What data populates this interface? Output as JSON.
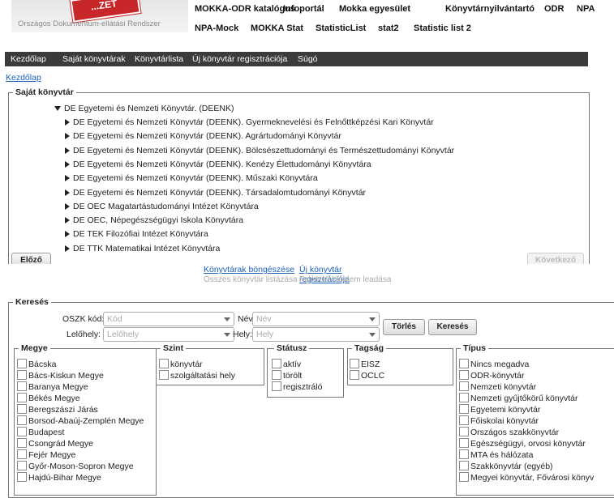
{
  "header": {
    "logo_stamp": "...ZET",
    "logo_caption": "Országos Dokumentum-ellátási Rendszer",
    "top_nav_row1": [
      "MOKKA-ODR katalógus",
      "Infoportál",
      "Mokka egyesület",
      "Könyvtárnyilvántartó",
      "ODR",
      "NPA"
    ],
    "top_nav_row2": [
      "NPA-Mock",
      "MOKKA Stat",
      "StatisticList",
      "stat2",
      "Statistic list 2"
    ]
  },
  "menubar": [
    "Kezdőlap",
    "Saját könyvtárak",
    "Könyvtárlista",
    "Új könyvtár regisztrációja",
    "Súgó"
  ],
  "breadcrumb": "Kezdőlap",
  "own_libraries": {
    "legend": "Saját könyvtár",
    "root": "DE Egyetemi és Nemzeti Könyvtár. (DEENK)",
    "children": [
      "DE Egyetemi és Nemzeti Könyvtár (DEENK). Gyermeknevelési és Felnőttképzési Kari Könyvtár",
      "DE Egyetemi és Nemzeti Könyvtár (DEENK). Agrártudományi Könyvtár",
      "DE Egyetemi és Nemzeti Könyvtár (DEENK). Bölcsészettudományi és Természettudományi Könyvtár",
      "DE Egyetemi és Nemzeti Könyvtár (DEENK). Kenézy Élettudományi Könyvtára",
      "DE Egyetemi és Nemzeti Könyvtár (DEENK). Műszaki Könyvtára",
      "DE Egyetemi és Nemzeti Könyvtár (DEENK). Társadalomtudományi Könyvtár",
      "DE OEC Magatartástudományi Intézet Könyvtára",
      "DE OEC, Népegészségügyi Iskola Könyvtára",
      "DE TEK Filozófiai Intézet Könyvtára",
      "DE TTK Matematikai Intézet Könyvtára"
    ],
    "prev_label": "Előző",
    "next_label": "Következő"
  },
  "links": {
    "browse": "Könyvtárak böngészése",
    "browse_sub": "Összes könyvtár listázása",
    "register": "Új könyvtár regisztrációja",
    "register_sub": "Felvételi kérelem leadása"
  },
  "search": {
    "legend": "Keresés",
    "oszk_label": "OSZK kód:",
    "oszk_placeholder": "Kód",
    "name_label": "Név",
    "name_placeholder": "Név",
    "location_label": "Lelőhely:",
    "location_placeholder": "Lelőhely",
    "place_label": "Hely:",
    "place_placeholder": "Hely",
    "clear_label": "Törlés",
    "search_label": "Keresés"
  },
  "filters": {
    "county": {
      "legend": "Megye",
      "items": [
        "Bácska",
        "Bács-Kiskun Megye",
        "Baranya Megye",
        "Békés Megye",
        "Beregszászi Járás",
        "Borsod-Abaúj-Zemplén Megye",
        "Budapest",
        "Csongrád Megye",
        "Fejér Megye",
        "Győr-Moson-Sopron Megye",
        "Hajdú-Bihar Megye"
      ]
    },
    "level": {
      "legend": "Szint",
      "items": [
        "könyvtár",
        "szolgáltatási hely"
      ]
    },
    "status": {
      "legend": "Státusz",
      "items": [
        "aktív",
        "törölt",
        "regisztráló"
      ]
    },
    "membership": {
      "legend": "Tagság",
      "items": [
        "EISZ",
        "OCLC"
      ]
    },
    "type": {
      "legend": "Típus",
      "items": [
        "Nincs megadva",
        "ODR-könyvtár",
        "Nemzeti könyvtár",
        "Nemzeti gyűjtőkörű könyvtár",
        "Egyetemi könyvtár",
        "Főiskolai könyvtár",
        "Országos szakkönyvtár",
        "Egészségügyi, orvosi könyvtár",
        "MTA és hálózata",
        "Szakkönyvtár (egyéb)",
        "Megyei könyvtár, Fővárosi könyv"
      ]
    }
  }
}
